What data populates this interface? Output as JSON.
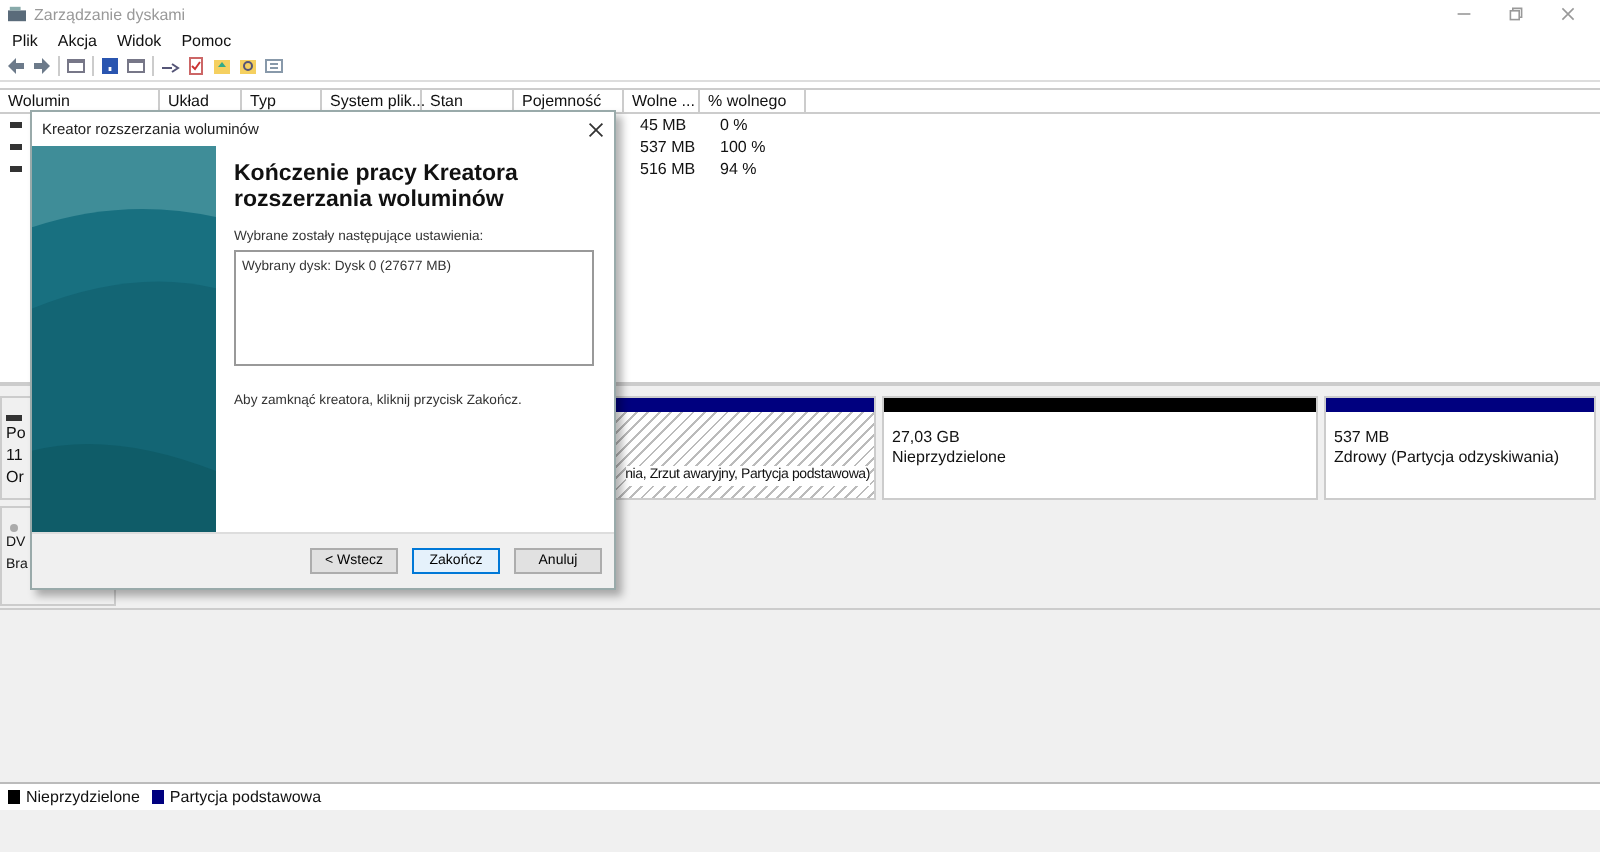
{
  "window": {
    "title": "Zarządzanie dyskami"
  },
  "menu": [
    "Plik",
    "Akcja",
    "Widok",
    "Pomoc"
  ],
  "table": {
    "columns": [
      "Wolumin",
      "Układ",
      "Typ",
      "System plik...",
      "Stan",
      "Pojemność",
      "Wolne ...",
      "% wolnego"
    ],
    "rows": [
      [
        "45 MB",
        "0 %"
      ],
      [
        "537 MB",
        "100 %"
      ],
      [
        "516 MB",
        "94 %"
      ]
    ]
  },
  "disks": [
    {
      "kind": "disk",
      "label_fragments": [
        "Po",
        "11",
        "Or"
      ],
      "partitions": [
        {
          "kind": "primary",
          "status": "nia, Zrzut awaryjny, Partycja podstawowa)",
          "color": "#00007f"
        },
        {
          "kind": "unallocated",
          "size": "27,03 GB",
          "status": "Nieprzydzielone",
          "color": "#000000"
        },
        {
          "kind": "primary",
          "size": "537 MB",
          "status": "Zdrowy (Partycja odzyskiwania)",
          "color": "#00007f"
        }
      ]
    },
    {
      "kind": "cdrom",
      "label_fragments": [
        "DV",
        "Bra"
      ]
    }
  ],
  "legend": [
    {
      "label": "Nieprzydzielone",
      "color": "#000000"
    },
    {
      "label": "Partycja podstawowa",
      "color": "#00007f"
    }
  ],
  "dialog": {
    "title": "Kreator rozszerzania woluminów",
    "heading": "Kończenie pracy Kreatora rozszerzania woluminów",
    "settings_label": "Wybrane zostały następujące ustawienia:",
    "settings_text": "Wybrany dysk: Dysk 0 (27677 MB)",
    "finish_note": "Aby zamknąć kreatora, kliknij przycisk Zakończ.",
    "buttons": [
      {
        "label": "< Wstecz",
        "selected": false
      },
      {
        "label": "Zakończ",
        "selected": true
      },
      {
        "label": "Anuluj",
        "selected": false
      }
    ]
  }
}
